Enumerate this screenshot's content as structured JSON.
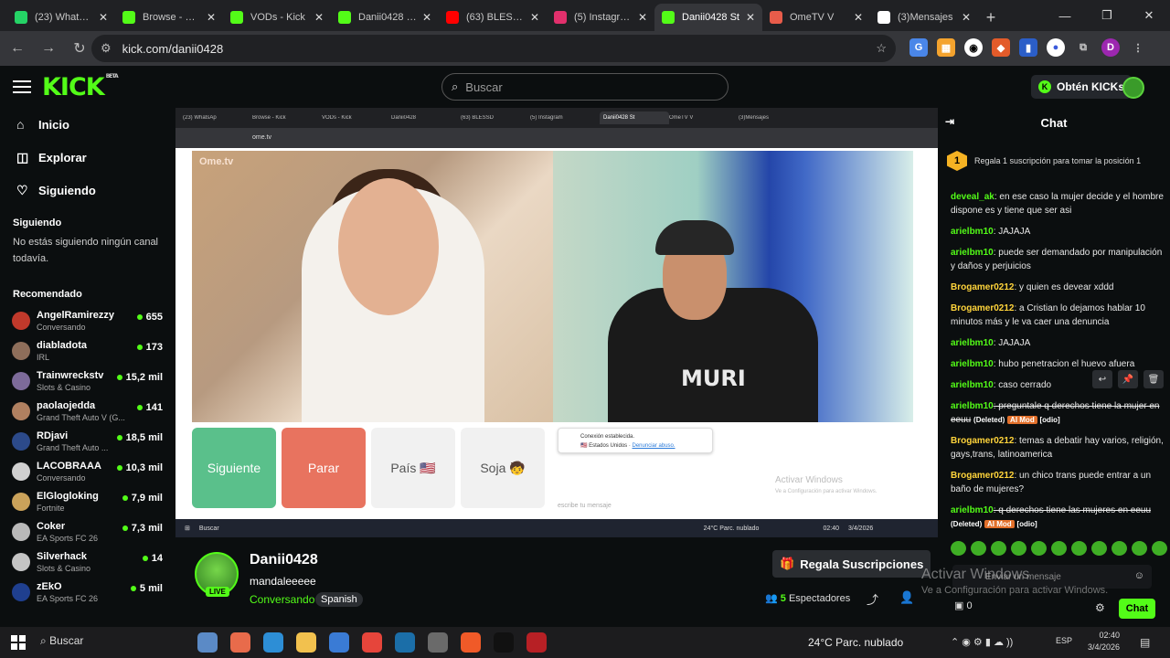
{
  "browser": {
    "tabs": [
      {
        "title": "(23) WhatsApp",
        "color": "#25d366",
        "icon": "whatsapp-icon"
      },
      {
        "title": "Browse - Kick",
        "color": "#53fc18",
        "icon": "kick-icon"
      },
      {
        "title": "VODs - Kick",
        "color": "#53fc18",
        "icon": "kick-icon"
      },
      {
        "title": "Danii0428 - V",
        "color": "#53fc18",
        "icon": "kick-icon"
      },
      {
        "title": "(63) BLESSD",
        "color": "#ff0000",
        "icon": "youtube-icon"
      },
      {
        "title": "(5) Instagram",
        "color": "#e1306c",
        "icon": "instagram-icon"
      },
      {
        "title": "Danii0428 St",
        "color": "#53fc18",
        "icon": "kick-icon"
      },
      {
        "title": "OmeTV V",
        "color": "#e85c4a",
        "icon": "ometv-icon"
      },
      {
        "title": "(3)Mensajes",
        "color": "#ffffff",
        "icon": "tiktok-icon"
      }
    ],
    "active_tab": 6,
    "url": "kick.com/danii0428",
    "window_controls": [
      "—",
      "❐",
      "✕"
    ]
  },
  "header": {
    "logo": "KICK",
    "logo_badge": "BETA",
    "search_placeholder": "Buscar",
    "kicks_button": "Obtén KICKs"
  },
  "sidebar": {
    "nav": [
      {
        "label": "Inicio",
        "icon": "home-icon"
      },
      {
        "label": "Explorar",
        "icon": "compass-icon"
      },
      {
        "label": "Siguiendo",
        "icon": "heart-icon"
      }
    ],
    "following_title": "Siguiendo",
    "following_empty": "No estás siguiendo ningún canal todavía.",
    "recommended_title": "Recomendado",
    "recommended": [
      {
        "name": "AngelRamirezzy",
        "category": "Conversando",
        "viewers": "655",
        "color": "#c0392b"
      },
      {
        "name": "diabladota",
        "category": "IRL",
        "viewers": "173",
        "color": "#8e6e5a"
      },
      {
        "name": "Trainwreckstv",
        "category": "Slots & Casino",
        "viewers": "15,2 mil",
        "color": "#7d6b9a"
      },
      {
        "name": "paolaojedda",
        "category": "Grand Theft Auto V (G...",
        "viewers": "141",
        "color": "#b08060"
      },
      {
        "name": "RDjavi",
        "category": "Grand Theft Auto ...",
        "viewers": "18,5 mil",
        "color": "#2c4a8a"
      },
      {
        "name": "LACOBRAAA",
        "category": "Conversando",
        "viewers": "10,3 mil",
        "color": "#d0d0d0"
      },
      {
        "name": "ElGlogloking",
        "category": "Fortnite",
        "viewers": "7,9 mil",
        "color": "#caa25a"
      },
      {
        "name": "Coker",
        "category": "EA Sports FC 26",
        "viewers": "7,3 mil",
        "color": "#b9b9b9"
      },
      {
        "name": "Silverhack",
        "category": "Slots & Casino",
        "viewers": "14",
        "color": "#c4c4c4"
      },
      {
        "name": "zEkO",
        "category": "EA Sports FC 26",
        "viewers": "5 mil",
        "color": "#1f3f8f"
      }
    ]
  },
  "stream_inner": {
    "tabs": [
      "(23) WhatsAp",
      "Browse - Kick",
      "VODs - Kick",
      "Danii0428",
      "(63) BLESSD",
      "(5) Instagram",
      "Danii0428 St",
      "OmeTV V",
      "(3)Mensajes"
    ],
    "url": "ome.tv",
    "ome_logo": "Ome.tv",
    "shirt_text": "MURI",
    "buttons": [
      {
        "label": "Siguiente",
        "style": "g"
      },
      {
        "label": "Parar",
        "style": "r"
      },
      {
        "label": "País 🇺🇸",
        "style": "w"
      },
      {
        "label": "Soja 🧒",
        "style": "w"
      }
    ],
    "conn_title": "Conexión establecida.",
    "conn_country": "🇺🇸 Estados Unidos",
    "conn_report": "Denunciar abuso.",
    "activate_title": "Activar Windows",
    "activate_sub": "Ve a Configuración para activar Windows.",
    "message_placeholder": "escribe tu mensaje",
    "taskbar_search": "Buscar",
    "taskbar_weather": "24°C Parc. nublado",
    "taskbar_time": "02:40",
    "taskbar_date": "3/4/2026"
  },
  "streamer": {
    "name": "Danii0428",
    "title": "mandaleeeee",
    "category": "Conversando",
    "language": "Spanish",
    "live": "LIVE",
    "gift_button": "Regala Suscripciones",
    "viewers_count": "5",
    "viewers_label": "Espectadores"
  },
  "chat": {
    "title": "Chat",
    "pinned_count": "1",
    "pinned_text": "Regala 1 suscripción para tomar la posición 1",
    "messages": [
      {
        "user": "deveal_ak",
        "cls": "a",
        "text": ": en ese caso la mujer decide y el hombre dispone es y tiene que ser asi",
        "strike": false,
        "deleted": false
      },
      {
        "user": "arielbm10",
        "cls": "a",
        "text": ": JAJAJA",
        "strike": false,
        "deleted": false
      },
      {
        "user": "arielbm10",
        "cls": "a",
        "text": ": puede ser demandado por manipulación y daños y perjuicios",
        "strike": false,
        "deleted": false
      },
      {
        "user": "Brogamer0212",
        "cls": "b",
        "text": ": y quien es devear xddd",
        "strike": false,
        "deleted": false
      },
      {
        "user": "Brogamer0212",
        "cls": "b",
        "text": ": a Cristian lo dejamos hablar 10 minutos más y le va caer una denuncia",
        "strike": false,
        "deleted": false
      },
      {
        "user": "arielbm10",
        "cls": "a",
        "text": ": JAJAJA",
        "strike": false,
        "deleted": false
      },
      {
        "user": "arielbm10",
        "cls": "a",
        "text": ": hubo penetracion el huevo afuera",
        "strike": false,
        "deleted": false
      },
      {
        "user": "arielbm10",
        "cls": "a",
        "text": ": caso cerrado",
        "strike": false,
        "deleted": false
      },
      {
        "user": "arielbm10",
        "cls": "a",
        "text": ": preguntale q derechos tiene la mujer en eeuu",
        "strike": true,
        "deleted": true
      },
      {
        "user": "Brogamer0212",
        "cls": "b",
        "text": ": temas a debatir hay varios, religión, gays,trans, latinoamerica",
        "strike": false,
        "deleted": false
      },
      {
        "user": "Brogamer0212",
        "cls": "b",
        "text": ": un chico trans puede entrar a un baño de mujeres?",
        "strike": false,
        "deleted": false
      },
      {
        "user": "arielbm10",
        "cls": "a",
        "text": ": q derechos tiene las mujeres en eeuu",
        "strike": true,
        "deleted": true
      }
    ],
    "deleted_label": "(Deleted)",
    "mod_label": "AI Mod",
    "odio_label": "[odio]",
    "input_placeholder": "Enviar un mensaje",
    "kicks_balance": "0",
    "send_button": "Chat",
    "activate_title": "Activar Windows",
    "activate_sub": "Ve a Configuración para activar Windows."
  },
  "taskbar": {
    "search": "Buscar",
    "weather": "24°C  Parc. nublado",
    "lang": "ESP",
    "time": "02:40",
    "date": "3/4/2026",
    "apps": [
      "#5b8ac6",
      "#e86b4b",
      "#2d8ed6",
      "#f2c14e",
      "#3a7bd5",
      "#e6453b",
      "#1b6ea8",
      "#6a6a6a",
      "#f05a28",
      "#111111",
      "#b72025"
    ]
  }
}
